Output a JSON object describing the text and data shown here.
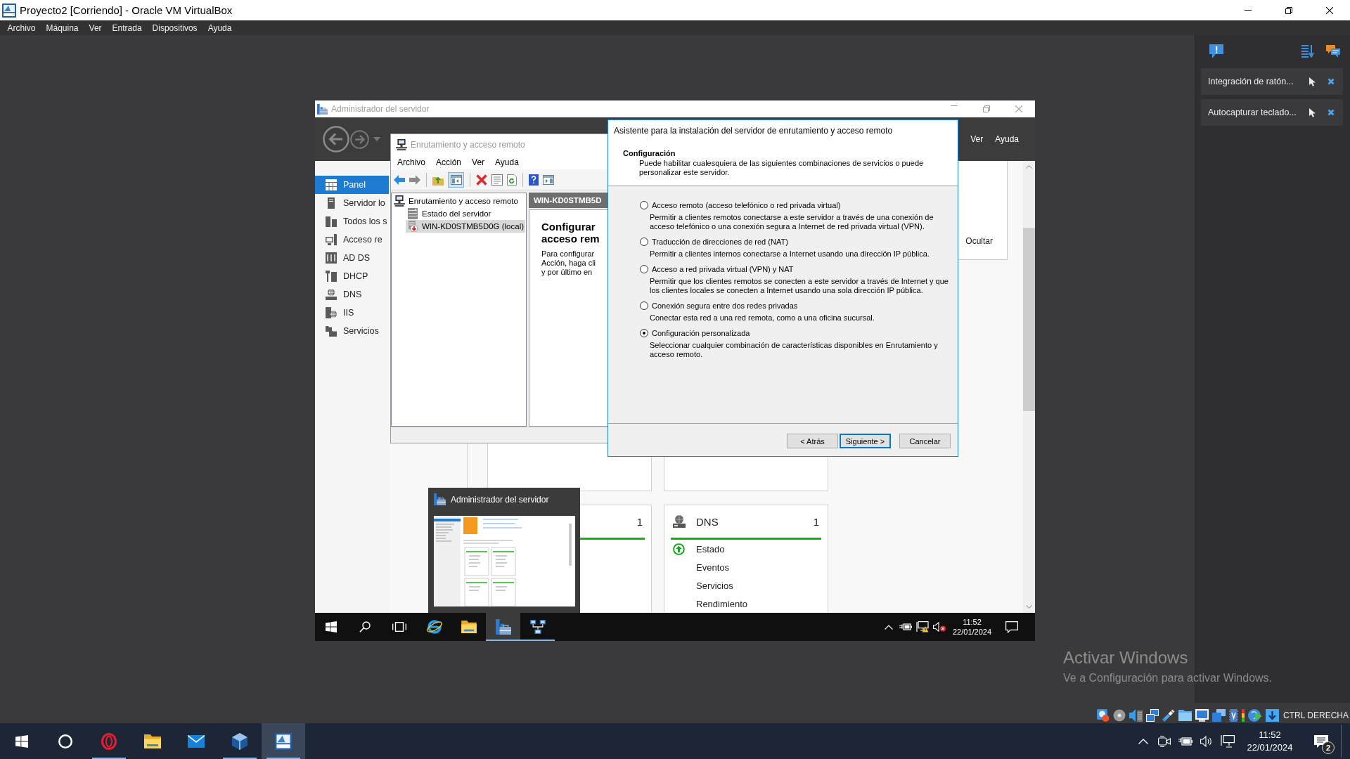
{
  "window": {
    "title": "Proyecto2 [Corriendo] - Oracle VM VirtualBox"
  },
  "menu": [
    "Archivo",
    "Máquina",
    "Ver",
    "Entrada",
    "Dispositivos",
    "Ayuda"
  ],
  "guest": {
    "server_manager": {
      "title": "Administrador del servidor",
      "menu": [
        "Ver",
        "Ayuda"
      ],
      "nav": [
        {
          "label": "Panel",
          "selected": true
        },
        {
          "label": "Servidor lo",
          "selected": false
        },
        {
          "label": "Todos los s",
          "selected": false
        },
        {
          "label": "Acceso re",
          "selected": false
        },
        {
          "label": "AD DS",
          "selected": false
        },
        {
          "label": "DHCP",
          "selected": false
        },
        {
          "label": "DNS",
          "selected": false
        },
        {
          "label": "IIS",
          "selected": false
        },
        {
          "label": "Servicios",
          "selected": false
        }
      ],
      "hide_link": "Ocultar",
      "tiles": [
        {
          "count": "1"
        },
        {
          "title": "DNS",
          "count": "1",
          "rows": [
            {
              "kind": "status",
              "label": "Estado"
            },
            {
              "kind": "link",
              "label": "Eventos"
            },
            {
              "kind": "link",
              "label": "Servicios"
            },
            {
              "kind": "link",
              "label": "Rendimiento"
            }
          ]
        }
      ]
    },
    "routing": {
      "title": "Enrutamiento y acceso remoto",
      "menu": [
        "Archivo",
        "Acción",
        "Ver",
        "Ayuda"
      ],
      "console_tree_on": true,
      "tree": [
        {
          "label": "Enrutamiento y acceso remoto",
          "selected": false,
          "children": [
            {
              "label": "Estado del servidor",
              "selected": false
            },
            {
              "label": "WIN-KD0STMB5D0G (local)",
              "selected": true
            }
          ]
        }
      ],
      "detail": {
        "header": "WIN-KD0STMB5D",
        "heading": [
          "Configurar",
          "acceso rem"
        ],
        "body": [
          "Para configurar",
          "Acción, haga cli",
          "y por último en"
        ]
      }
    },
    "wizard": {
      "title": "Asistente para la instalación del servidor de enrutamiento y acceso remoto",
      "heading": "Configuración",
      "intro": "Puede habilitar cualesquiera de las siguientes combinaciones de servicios o puede personalizar este servidor.",
      "options": [
        {
          "label": "Acceso remoto (acceso telefónico o red privada virtual)",
          "description": "Permitir a clientes remotos conectarse a este servidor a través de una conexión de acceso telefónico o una conexión segura a Internet de red privada virtual (VPN).",
          "selected": false
        },
        {
          "label": "Traducción de direcciones de red (NAT)",
          "description": "Permitir a clientes internos conectarse a Internet usando una dirección IP pública.",
          "selected": false
        },
        {
          "label": "Acceso a red privada virtual (VPN) y NAT",
          "description": "Permitir que los clientes remotos se conecten a este servidor a través de Internet y que los clientes locales se conecten a Internet usando una sola dirección IP pública.",
          "selected": false
        },
        {
          "label": "Conexión segura entre dos redes privadas",
          "description": "Conectar esta red a una red remota, como a una oficina sucursal.",
          "selected": false
        },
        {
          "label": "Configuración personalizada",
          "description": "Seleccionar cualquier combinación de características disponibles en Enrutamiento y acceso remoto.",
          "selected": true
        }
      ],
      "buttons": [
        {
          "label": "< Atrás",
          "default": false
        },
        {
          "label": "Siguiente >",
          "default": true
        },
        {
          "label": "Cancelar",
          "default": false
        }
      ]
    },
    "preview": {
      "title": "Administrador del servidor"
    },
    "taskbar": {
      "apps": [
        {
          "running": false,
          "selected": false
        },
        {
          "running": false,
          "selected": false
        },
        {
          "running": true,
          "selected": true
        },
        {
          "running": true,
          "selected": false
        }
      ],
      "time": "11:52",
      "date": "22/01/2024"
    }
  },
  "side_panel": {
    "items": [
      "Integración de ratón...",
      "Autocapturar teclado..."
    ]
  },
  "activation": {
    "title": "Activar Windows",
    "message": "Ve a Configuración para activar Windows."
  },
  "status_bar": {
    "host_key": "CTRL DERECHA"
  },
  "taskbar": {
    "apps": [
      {
        "running": true,
        "selected": false
      },
      {
        "running": false,
        "selected": false
      },
      {
        "running": false,
        "selected": false
      },
      {
        "running": true,
        "selected": false
      },
      {
        "running": true,
        "selected": true
      }
    ],
    "time": "11:52",
    "date": "22/01/2024",
    "notifications": "2"
  }
}
